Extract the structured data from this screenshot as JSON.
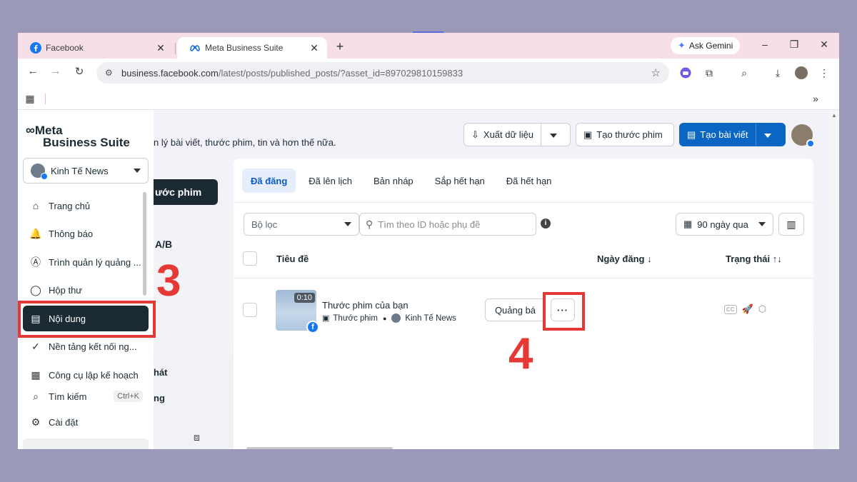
{
  "browser": {
    "tabs": [
      {
        "title": "Facebook",
        "icon": "facebook-icon"
      },
      {
        "title": "Meta Business Suite",
        "icon": "meta-icon"
      }
    ],
    "new_tab": "+",
    "gemini_label": "Ask Gemini",
    "url_host": "business.facebook.com",
    "url_path": "/latest/posts/published_posts/?asset_id=897029810159833",
    "more_label": "»"
  },
  "sidebar": {
    "logo_line1": "Meta",
    "logo_line2": "Business Suite",
    "account_name": "Kinh Tế News",
    "items": [
      {
        "label": "Trang chủ",
        "icon": "⌂"
      },
      {
        "label": "Thông báo",
        "icon": "🔔"
      },
      {
        "label": "Trình quản lý quảng ...",
        "icon": "Ⓐ"
      },
      {
        "label": "Hộp thư",
        "icon": "◯"
      },
      {
        "label": "Nội dung",
        "icon": "▤"
      },
      {
        "label": "Nền tảng kết nối ng...",
        "icon": "✓"
      },
      {
        "label": "Công cụ lập kế hoạch",
        "icon": "▦"
      },
      {
        "label": "Tìm kiếm",
        "icon": "⌕"
      },
      {
        "label": "Cài đặt",
        "icon": "⚙"
      }
    ],
    "search_shortcut": "Ctrl+K"
  },
  "behind": {
    "subtitle": "n lý bài viết, thước phim, tin và hơn thế nữa.",
    "dark_button": "ước phim",
    "fragment_ab": "A/B",
    "fragment_hat": "hát",
    "fragment_g": "ng"
  },
  "header": {
    "export_label": "Xuất dữ liệu",
    "create_reel_label": "Tạo thước phim",
    "create_post_label": "Tạo bài viết"
  },
  "content": {
    "tabs": [
      "Đã đăng",
      "Đã lên lịch",
      "Bản nháp",
      "Sắp hết hạn",
      "Đã hết hạn"
    ],
    "filter_placeholder": "Bộ lọc",
    "search_placeholder": "Tìm theo ID hoặc phụ đề",
    "date_range": "90 ngày qua",
    "columns": {
      "title": "Tiêu đề",
      "date": "Ngày đăng ↓",
      "status": "Trạng thái ↑↓"
    },
    "row": {
      "duration": "0:10",
      "title": "Thước phim của bạn",
      "type": "Thước phim",
      "page": "Kinh Tế News",
      "promote": "Quảng bá",
      "more": "···"
    }
  },
  "annotations": {
    "step3": "3",
    "step4": "4",
    "color": "#e53935"
  }
}
